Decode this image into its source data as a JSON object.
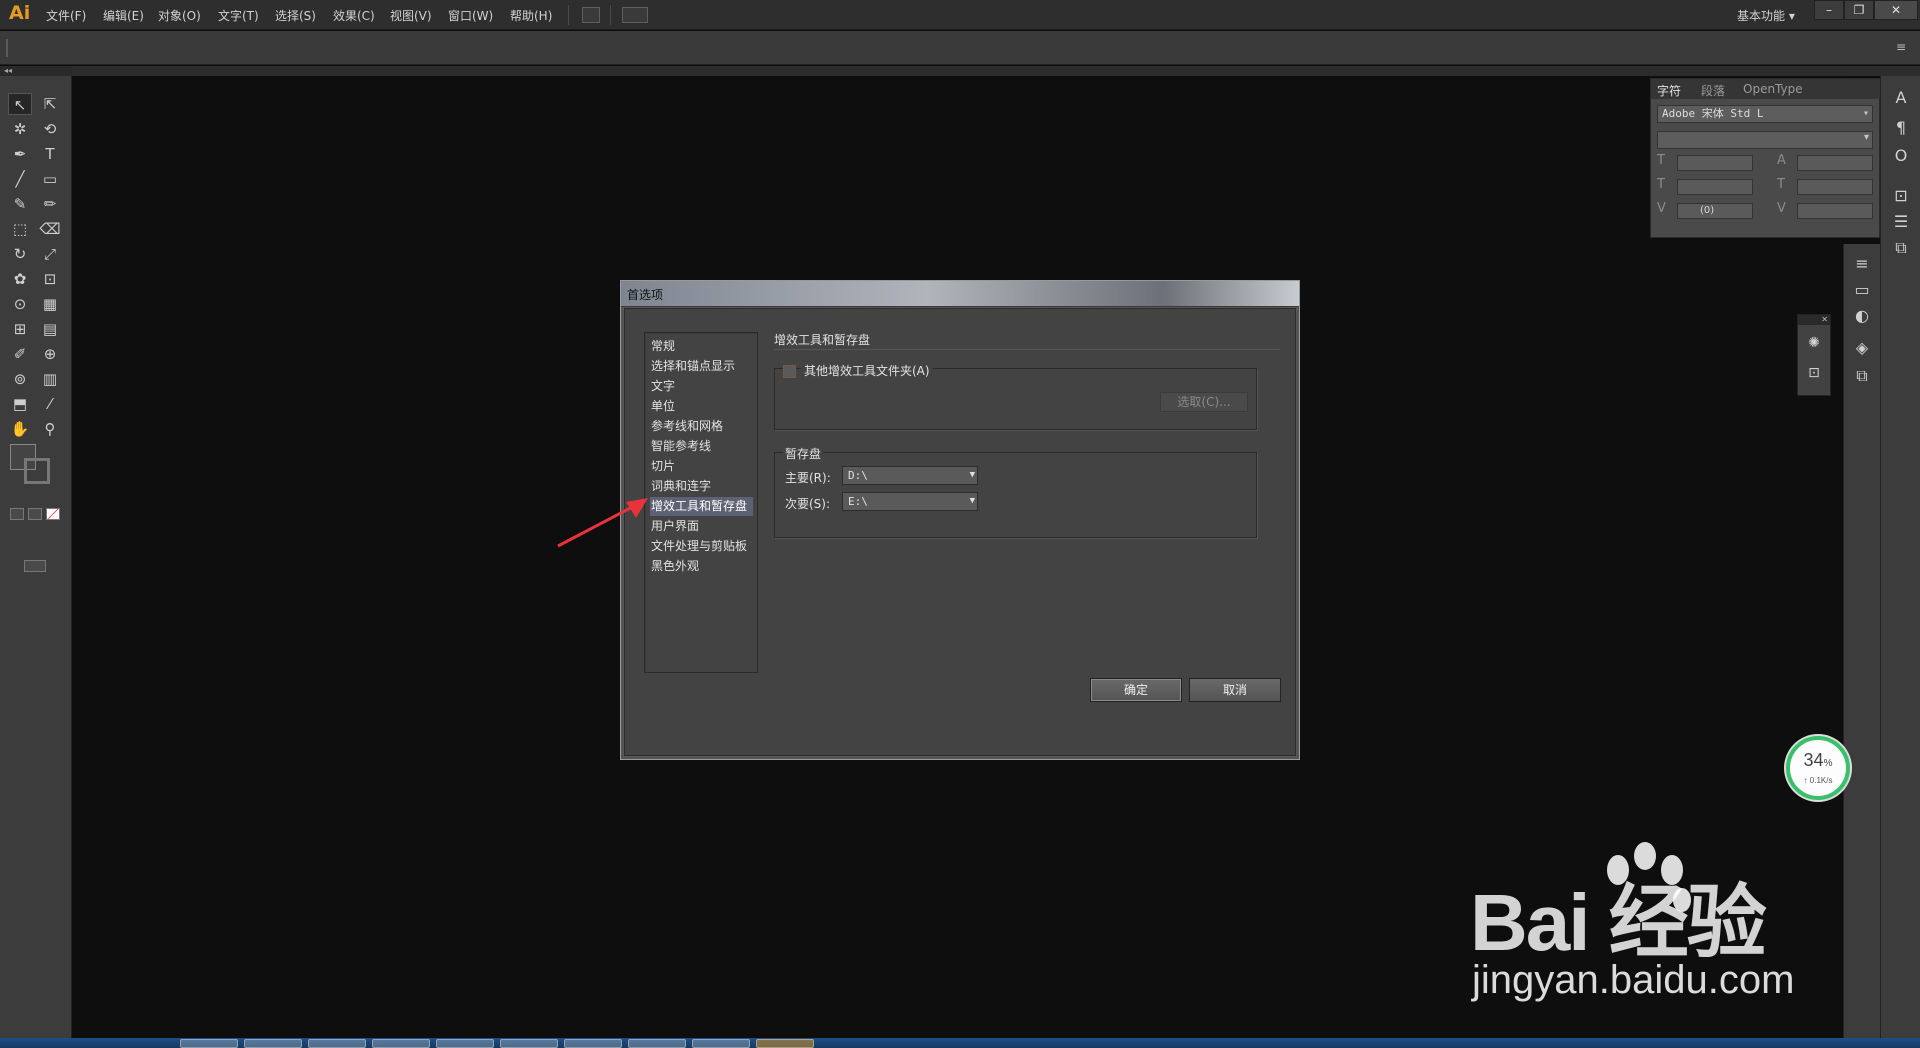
{
  "app": {
    "logo": "Ai",
    "workspace": "基本功能",
    "workspace_arrow": "▾"
  },
  "menubar": {
    "items": [
      "文件(F)",
      "编辑(E)",
      "对象(O)",
      "文字(T)",
      "选择(S)",
      "效果(C)",
      "视图(V)",
      "窗口(W)",
      "帮助(H)"
    ]
  },
  "window_controls": {
    "minimize": "–",
    "restore": "❐",
    "close": "✕"
  },
  "tools": {
    "header": "◂◂",
    "glyphs": [
      "↖",
      "⇱",
      "✲",
      "⟲",
      "✒",
      "T",
      "╱",
      "▭",
      "✎",
      "✏",
      "⬚",
      "⌫",
      "↻",
      "⤢",
      "✿",
      "⊡",
      "⊙",
      "▦",
      "⊞",
      "▤",
      "✐",
      "⊕",
      "⊚",
      "▥",
      "⬒",
      "⁄",
      "✋",
      "⚲"
    ]
  },
  "character_panel": {
    "tabs": [
      "字符",
      "段落",
      "OpenType"
    ],
    "active_tab": "字符",
    "font_family": "Adobe 宋体 Std L",
    "font_style": "",
    "tracking_value": "(0)",
    "field_icons": [
      "T",
      "A",
      "T",
      "T",
      "V",
      "V"
    ]
  },
  "dialog": {
    "title": "首选项",
    "categories": [
      "常规",
      "选择和锚点显示",
      "文字",
      "单位",
      "参考线和网格",
      "智能参考线",
      "切片",
      "词典和连字",
      "增效工具和暂存盘",
      "用户界面",
      "文件处理与剪贴板",
      "黑色外观"
    ],
    "selected_category": "增效工具和暂存盘",
    "section_title": "增效工具和暂存盘",
    "plugins": {
      "checkbox_label": "其他增效工具文件夹(A)",
      "checked": false,
      "choose_button": "选取(C)..."
    },
    "scratch": {
      "legend": "暂存盘",
      "primary_label": "主要(R):",
      "primary_value": "D:\\",
      "secondary_label": "次要(S):",
      "secondary_value": "E:\\"
    },
    "ok": "确定",
    "cancel": "取消"
  },
  "speed_widget": {
    "percent": "34",
    "percent_unit": "%",
    "rate": "↑ 0.1K/s",
    "ring_color": "#39c06b"
  },
  "watermark": {
    "brand": "Bai 经验",
    "url": "jingyan.baidu.com"
  },
  "colors": {
    "accent_logo": "#e69a24",
    "selection": "#5e6173",
    "annotation_arrow": "#e8333a"
  }
}
